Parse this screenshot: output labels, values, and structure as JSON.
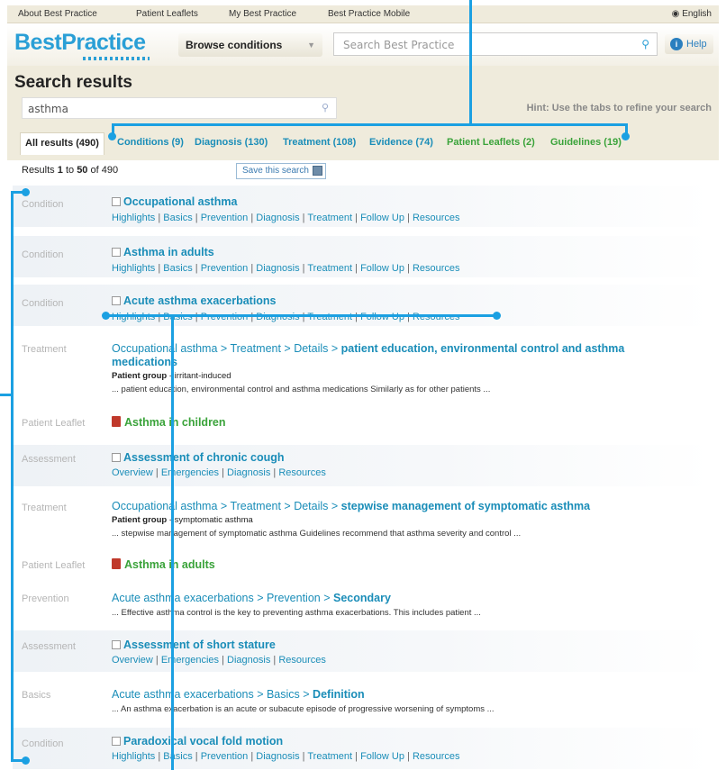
{
  "topnav": {
    "links": [
      "About Best Practice",
      "Patient Leaflets",
      "My Best Practice",
      "Best Practice Mobile"
    ],
    "language": "English"
  },
  "header": {
    "logo_part1": "Best",
    "logo_part2": "Practice",
    "browse_label": "Browse conditions",
    "search_placeholder": "Search Best Practice",
    "help_label": "Help"
  },
  "search": {
    "title": "Search results",
    "query": "asthma",
    "hint": "Hint: Use the tabs to refine your search"
  },
  "tabs": [
    {
      "label": "All results (490)"
    },
    {
      "label": "Conditions (9)"
    },
    {
      "label": "Diagnosis (130)"
    },
    {
      "label": "Treatment (108)"
    },
    {
      "label": "Evidence (74)"
    },
    {
      "label": "Patient Leaflets (2)"
    },
    {
      "label": "Guidelines (19)"
    }
  ],
  "results_count": {
    "prefix": "Results",
    "from": "1",
    "to_word": "to",
    "to": "50",
    "of_word": "of",
    "total": "490"
  },
  "save_search_label": "Save this search",
  "condition_links": [
    "Highlights",
    "Basics",
    "Prevention",
    "Diagnosis",
    "Treatment",
    "Follow Up",
    "Resources"
  ],
  "assessment_links": [
    "Overview",
    "Emergencies",
    "Diagnosis",
    "Resources"
  ],
  "results": [
    {
      "type": "Condition",
      "title": "Occupational asthma"
    },
    {
      "type": "Condition",
      "title": "Asthma in adults"
    },
    {
      "type": "Condition",
      "title": "Acute asthma exacerbations"
    },
    {
      "type": "Treatment",
      "crumb": "Occupational asthma > Treatment > Details >",
      "crumb_bold": "patient education, environmental control and asthma medications",
      "meta_label": "Patient group",
      "meta_value": " - irritant-induced",
      "snippet": "... patient education, environmental control and asthma medications Similarly as for other patients ..."
    },
    {
      "type": "Patient Leaflet",
      "title": "Asthma in children"
    },
    {
      "type": "Assessment",
      "title": "Assessment of chronic cough"
    },
    {
      "type": "Treatment",
      "crumb": "Occupational asthma > Treatment > Details >",
      "crumb_bold": "stepwise management of symptomatic asthma",
      "meta_label": "Patient group",
      "meta_value": " - symptomatic asthma",
      "snippet": "... stepwise management of symptomatic asthma Guidelines recommend that asthma severity and control ..."
    },
    {
      "type": "Patient Leaflet",
      "title": "Asthma in adults"
    },
    {
      "type": "Prevention",
      "crumb": "Acute asthma exacerbations > Prevention >",
      "crumb_bold": "Secondary",
      "snippet": "... Effective asthma control is the key to preventing asthma exacerbations. This includes patient ..."
    },
    {
      "type": "Assessment",
      "title": "Assessment of short stature"
    },
    {
      "type": "Basics",
      "crumb": "Acute asthma exacerbations > Basics >",
      "crumb_bold": "Definition",
      "snippet": "... An asthma exacerbation is an acute or subacute episode of progressive worsening of symptoms ..."
    },
    {
      "type": "Condition",
      "title": "Paradoxical vocal fold motion"
    }
  ],
  "colors": {
    "accent": "#1ba0e2",
    "link_blue": "#1a8db8",
    "leaflet_green": "#3aa33a",
    "band": "#efebdc"
  }
}
